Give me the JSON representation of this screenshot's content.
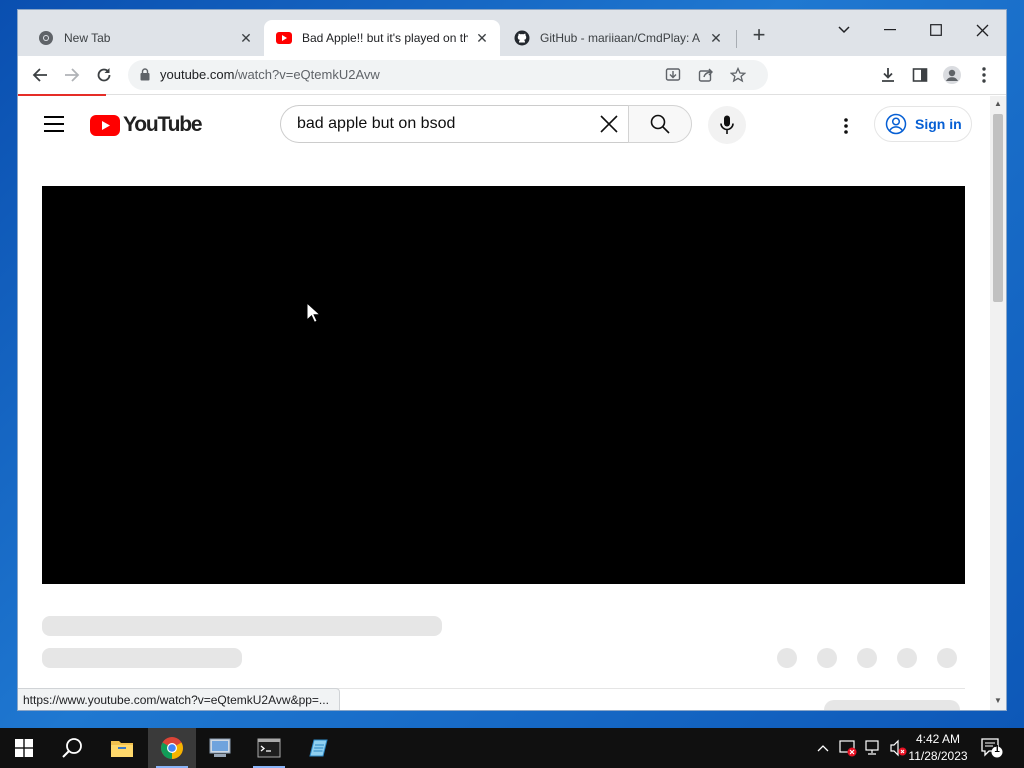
{
  "browser": {
    "tabs": [
      {
        "title": "New Tab",
        "favicon": "chrome-icon",
        "active": false
      },
      {
        "title": "Bad Apple!! but it's played on th",
        "favicon": "youtube-icon",
        "active": true
      },
      {
        "title": "GitHub - mariiaan/CmdPlay: A c",
        "favicon": "github-icon",
        "active": false
      }
    ],
    "url_host": "youtube.com",
    "url_path": "/watch?v=eQtemkU2Avw",
    "status_url": "https://www.youtube.com/watch?v=eQtemkU2Avw&pp=..."
  },
  "youtube": {
    "logo_text": "YouTube",
    "search_value": "bad apple but on bsod",
    "signin_label": "Sign in",
    "accent": "#ff0000",
    "link_color": "#065fd4"
  },
  "taskbar": {
    "time": "4:42 AM",
    "date": "11/28/2023",
    "notification_count": "1",
    "pinned": [
      "windows-start-icon",
      "search-icon",
      "file-explorer-icon",
      "chrome-icon",
      "control-panel-icon",
      "command-prompt-icon",
      "notepad-icon"
    ]
  }
}
